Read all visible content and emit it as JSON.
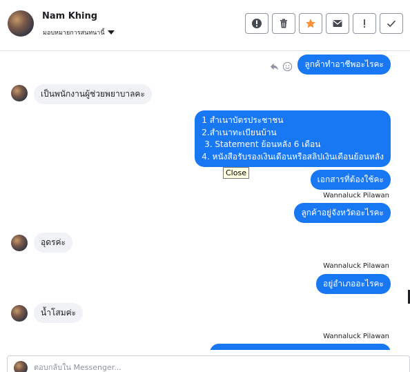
{
  "header": {
    "contact_name": "Nam Khing",
    "assign_label": "มอบหมายการสนทนานี้"
  },
  "toolbar": {
    "buttons": [
      {
        "icon": "alert-circle-icon"
      },
      {
        "icon": "trash-icon"
      },
      {
        "icon": "star-icon",
        "color": "#f7923a"
      },
      {
        "icon": "mail-icon"
      },
      {
        "icon": "exclamation-icon"
      },
      {
        "icon": "checkmark-icon"
      }
    ]
  },
  "messages": [
    {
      "dir": "out",
      "text": "ลูกค้าทำอาชีพอะไรคะ"
    },
    {
      "dir": "in",
      "text": "เป็นพนักงานผู้ช่วยพยาบาลคะ"
    },
    {
      "dir": "out",
      "lines": [
        "1 สำเนาบัตรประชาชน",
        "2.สำเนาทะเบียนบ้าน",
        " 3. Statement ย้อนหลัง 6 เดือน",
        "4. หนังสือรับรองเงินเดือนหรือสลิปเงินเดือนย้อนหลัง"
      ]
    },
    {
      "dir": "out",
      "text": "เอกสารที่ต้องใช้คะ"
    },
    {
      "dir": "out",
      "sender": "Wannaluck Pilawan",
      "text": "ลูกค้าอยู่จังหวัดอะไรคะ"
    },
    {
      "dir": "in",
      "text": "อุดรค่ะ"
    },
    {
      "dir": "out",
      "sender": "Wannaluck Pilawan",
      "text": "อยู่อำเภออะไรคะ"
    },
    {
      "dir": "in",
      "text": "น้ำโสมค่ะ"
    },
    {
      "dir": "out",
      "sender": "Wannaluck Pilawan",
      "text": ""
    }
  ],
  "tooltip": "Close",
  "reply": {
    "placeholder": "ตอบกลับใน Messenger..."
  },
  "colors": {
    "outgoing": "#1877f2",
    "incoming": "#f0f2f5",
    "star": "#f7923a"
  }
}
